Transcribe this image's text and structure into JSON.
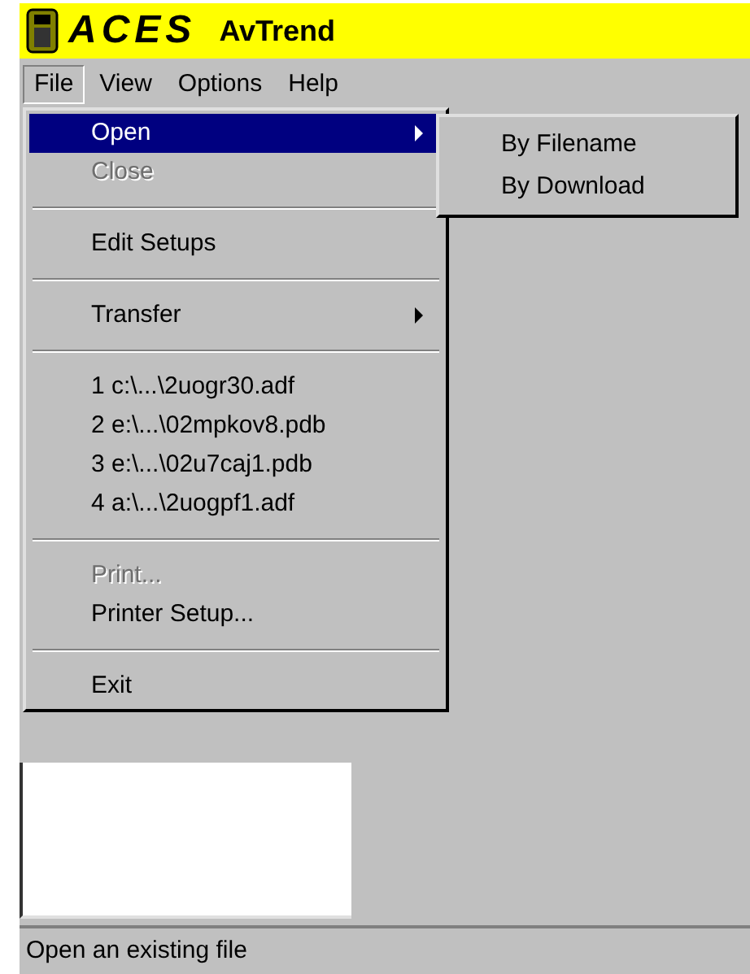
{
  "window": {
    "logo": "ACES",
    "title": "AvTrend"
  },
  "menubar": [
    {
      "label": "File",
      "selected": true
    },
    {
      "label": "View",
      "selected": false
    },
    {
      "label": "Options",
      "selected": false
    },
    {
      "label": "Help",
      "selected": false
    }
  ],
  "file_menu": [
    {
      "kind": "item",
      "label": "Open",
      "selected": true,
      "disabled": false,
      "submenu": true
    },
    {
      "kind": "item",
      "label": "Close",
      "selected": false,
      "disabled": true,
      "submenu": false
    },
    {
      "kind": "separator"
    },
    {
      "kind": "item",
      "label": "Edit Setups",
      "selected": false,
      "disabled": false,
      "submenu": false
    },
    {
      "kind": "separator"
    },
    {
      "kind": "item",
      "label": "Transfer",
      "selected": false,
      "disabled": false,
      "submenu": true
    },
    {
      "kind": "separator"
    },
    {
      "kind": "item",
      "label": "1 c:\\...\\2uogr30.adf",
      "selected": false,
      "disabled": false,
      "submenu": false
    },
    {
      "kind": "item",
      "label": "2 e:\\...\\02mpkov8.pdb",
      "selected": false,
      "disabled": false,
      "submenu": false
    },
    {
      "kind": "item",
      "label": "3 e:\\...\\02u7caj1.pdb",
      "selected": false,
      "disabled": false,
      "submenu": false
    },
    {
      "kind": "item",
      "label": "4 a:\\...\\2uogpf1.adf",
      "selected": false,
      "disabled": false,
      "submenu": false
    },
    {
      "kind": "separator"
    },
    {
      "kind": "item",
      "label": "Print...",
      "selected": false,
      "disabled": true,
      "submenu": false
    },
    {
      "kind": "item",
      "label": "Printer Setup...",
      "selected": false,
      "disabled": false,
      "submenu": false
    },
    {
      "kind": "separator"
    },
    {
      "kind": "item",
      "label": "Exit",
      "selected": false,
      "disabled": false,
      "submenu": false
    }
  ],
  "open_submenu": [
    {
      "label": "By Filename"
    },
    {
      "label": "By Download"
    }
  ],
  "status_bar": "Open an existing file"
}
